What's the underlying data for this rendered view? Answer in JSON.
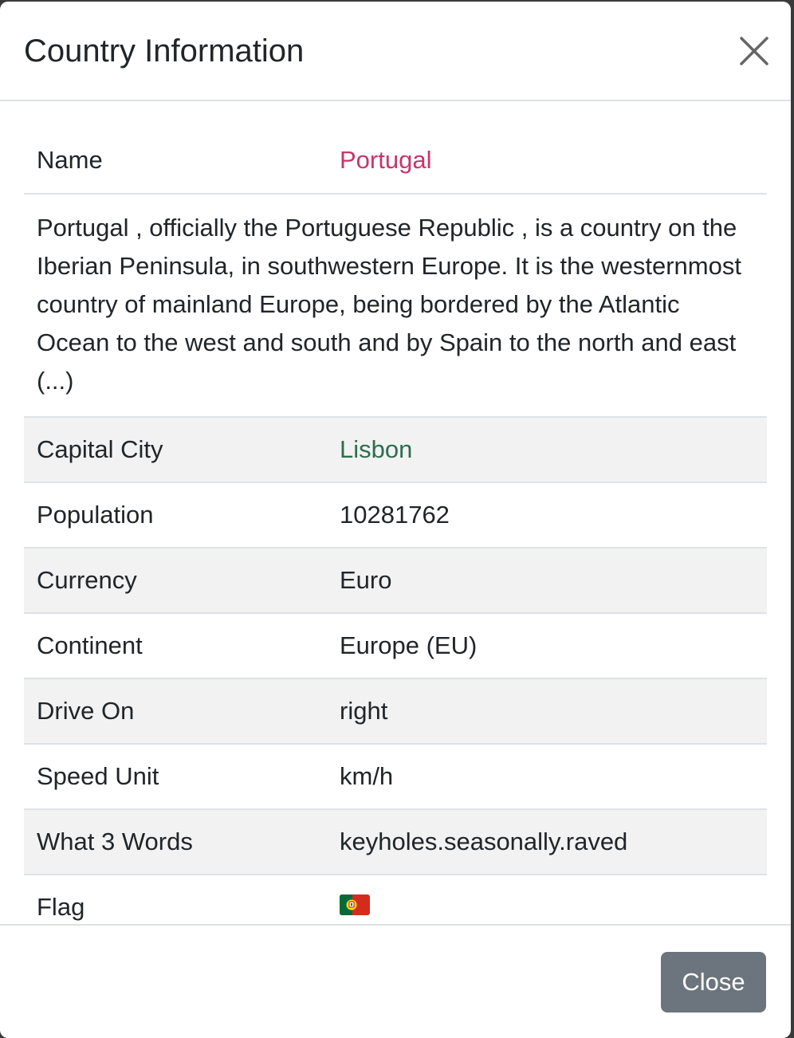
{
  "modal": {
    "title": "Country Information",
    "close_button_label": "Close"
  },
  "country": {
    "name_label": "Name",
    "name_value": "Portugal",
    "description": "Portugal , officially the Portuguese Republic , is a country on the Iberian Peninsula, in southwestern Europe. It is the westernmost country of mainland Europe, being bordered by the Atlantic Ocean to the west and south and by Spain to the north and east (...)",
    "rows": [
      {
        "label": "Capital City",
        "value": "Lisbon"
      },
      {
        "label": "Population",
        "value": "10281762"
      },
      {
        "label": "Currency",
        "value": "Euro"
      },
      {
        "label": "Continent",
        "value": "Europe (EU)"
      },
      {
        "label": "Drive On",
        "value": "right"
      },
      {
        "label": "Speed Unit",
        "value": "km/h"
      },
      {
        "label": "What 3 Words",
        "value": "keyholes.seasonally.raved"
      },
      {
        "label": "Flag",
        "value": "🇵🇹"
      }
    ]
  },
  "colors": {
    "name_value": "#c7366a",
    "capital_value": "#2c6e4f",
    "close_button_bg": "#6c757d",
    "stripe": "#f2f2f2"
  },
  "icons": {
    "close": "close-icon",
    "flag": "portugal-flag-icon"
  }
}
